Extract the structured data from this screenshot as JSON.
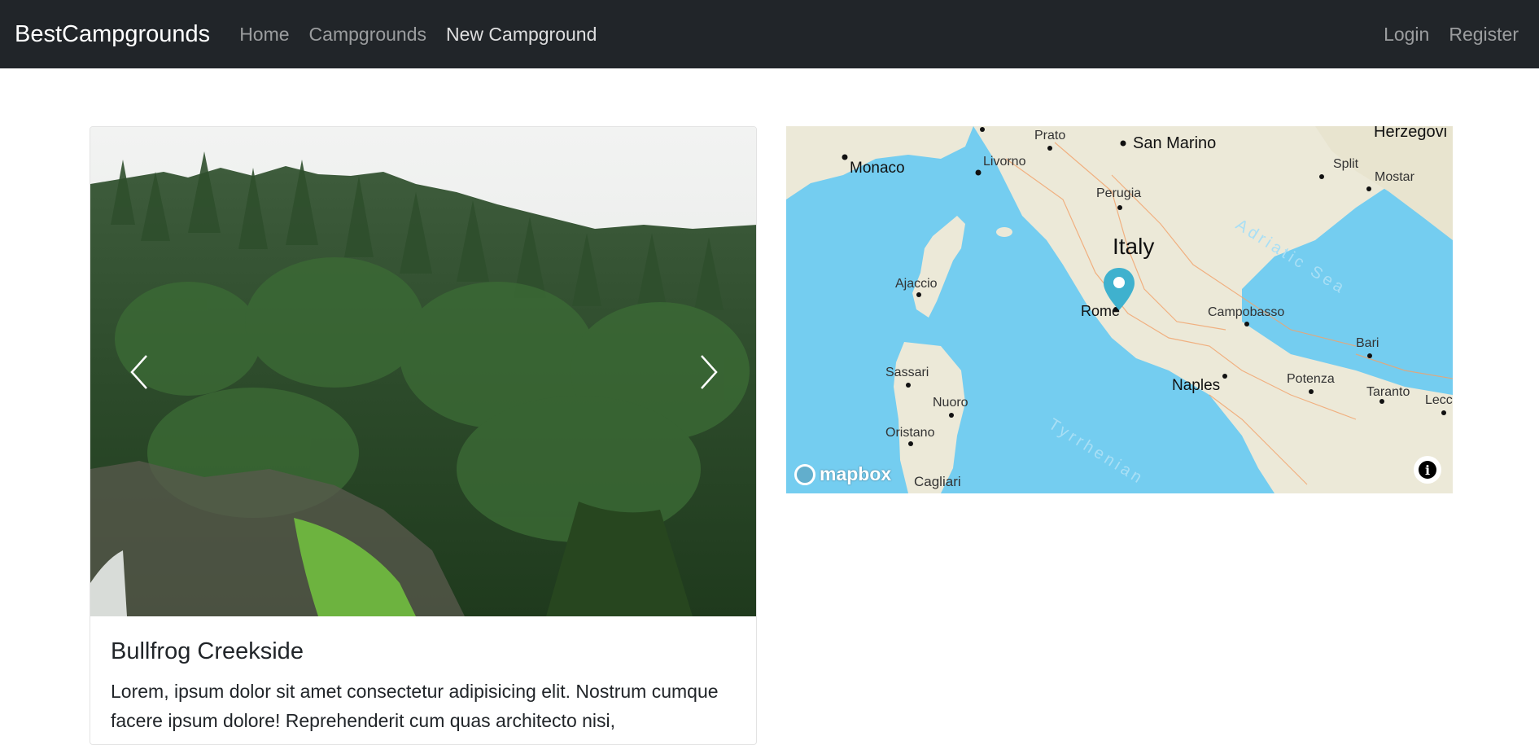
{
  "navbar": {
    "brand": "BestCampgrounds",
    "links": [
      {
        "label": "Home"
      },
      {
        "label": "Campgrounds"
      },
      {
        "label": "New Campground"
      }
    ],
    "right_links": [
      {
        "label": "Login"
      },
      {
        "label": "Register"
      }
    ]
  },
  "campground": {
    "title": "Bullfrog Creekside",
    "description": "Lorem, ipsum dolor sit amet consectetur adipisicing elit. Nostrum cumque facere ipsum dolore! Reprehenderit cum quas architecto nisi,"
  },
  "carousel": {
    "prev_icon": "chevron-left-icon",
    "next_icon": "chevron-right-icon"
  },
  "map": {
    "labels": {
      "monaco": "Monaco",
      "livorno": "Livorno",
      "prato": "Prato",
      "san_marino": "San Marino",
      "perugia": "Perugia",
      "italy": "Italy",
      "adriatic": "Adriatic Sea",
      "split": "Split",
      "mostar": "Mostar",
      "herzegovi": "Herzegovi",
      "ajaccio": "Ajaccio",
      "rome": "Rome",
      "campobasso": "Campobasso",
      "bari": "Bari",
      "sassari": "Sassari",
      "nuoro": "Nuoro",
      "naples": "Naples",
      "potenza": "Potenza",
      "taranto": "Taranto",
      "lecce": "Lecc",
      "oristano": "Oristano",
      "tyrrhenian": "Tyrrhenian",
      "cagliari": "Cagliari"
    },
    "attribution": "mapbox",
    "info_icon": "info-icon",
    "marker_icon": "map-pin-icon",
    "colors": {
      "water": "#74cdf0",
      "land": "#ece9d8",
      "marker": "#3fb1ce"
    }
  }
}
